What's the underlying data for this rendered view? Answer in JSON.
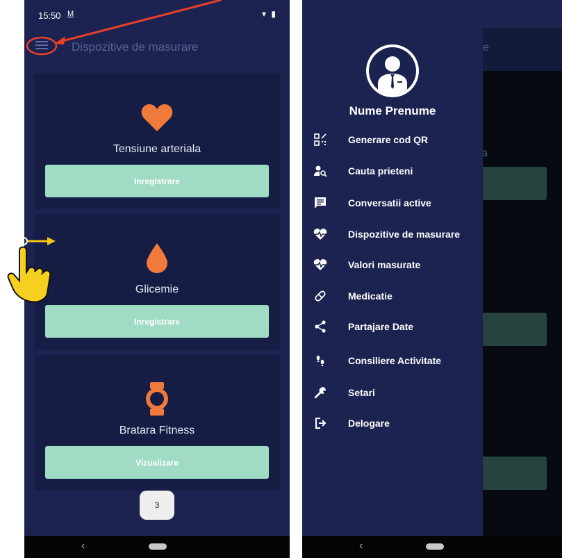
{
  "colors": {
    "accent": "#a0dcc4",
    "background": "#1c2350",
    "card": "#161d45",
    "icon_orange": "#f07a3a"
  },
  "left_screen": {
    "status_time": "15:50",
    "status_extra": "M",
    "app_title": "Dispozitive de masurare",
    "cards": [
      {
        "icon": "heart-icon",
        "label": "Tensiune arteriala",
        "button": "Inregistrare"
      },
      {
        "icon": "drop-icon",
        "label": "Glicemie",
        "button": "Inregistrare"
      },
      {
        "icon": "watch-icon",
        "label": "Bratara Fitness",
        "button": "Vizualizare"
      }
    ],
    "page_number": "3"
  },
  "drawer": {
    "user_name": "Nume Prenume",
    "items": [
      {
        "icon": "qr-code-icon",
        "label": "Generare cod QR"
      },
      {
        "icon": "person-search-icon",
        "label": "Cauta prieteni"
      },
      {
        "icon": "chat-icon",
        "label": "Conversatii active"
      },
      {
        "icon": "heart-pulse-icon",
        "label": "Dispozitive de masurare"
      },
      {
        "icon": "heart-pulse-icon",
        "label": "Valori masurate"
      },
      {
        "icon": "pill-icon",
        "label": "Medicatie"
      },
      {
        "icon": "share-icon",
        "label": "Partajare Date"
      },
      {
        "icon": "footsteps-icon",
        "label": "Consiliere Activitate"
      },
      {
        "icon": "wrench-icon",
        "label": "Setari"
      },
      {
        "icon": "logout-icon",
        "label": "Delogare"
      }
    ]
  },
  "right_background": {
    "title_fragment": "e",
    "label_fragment": "a"
  }
}
